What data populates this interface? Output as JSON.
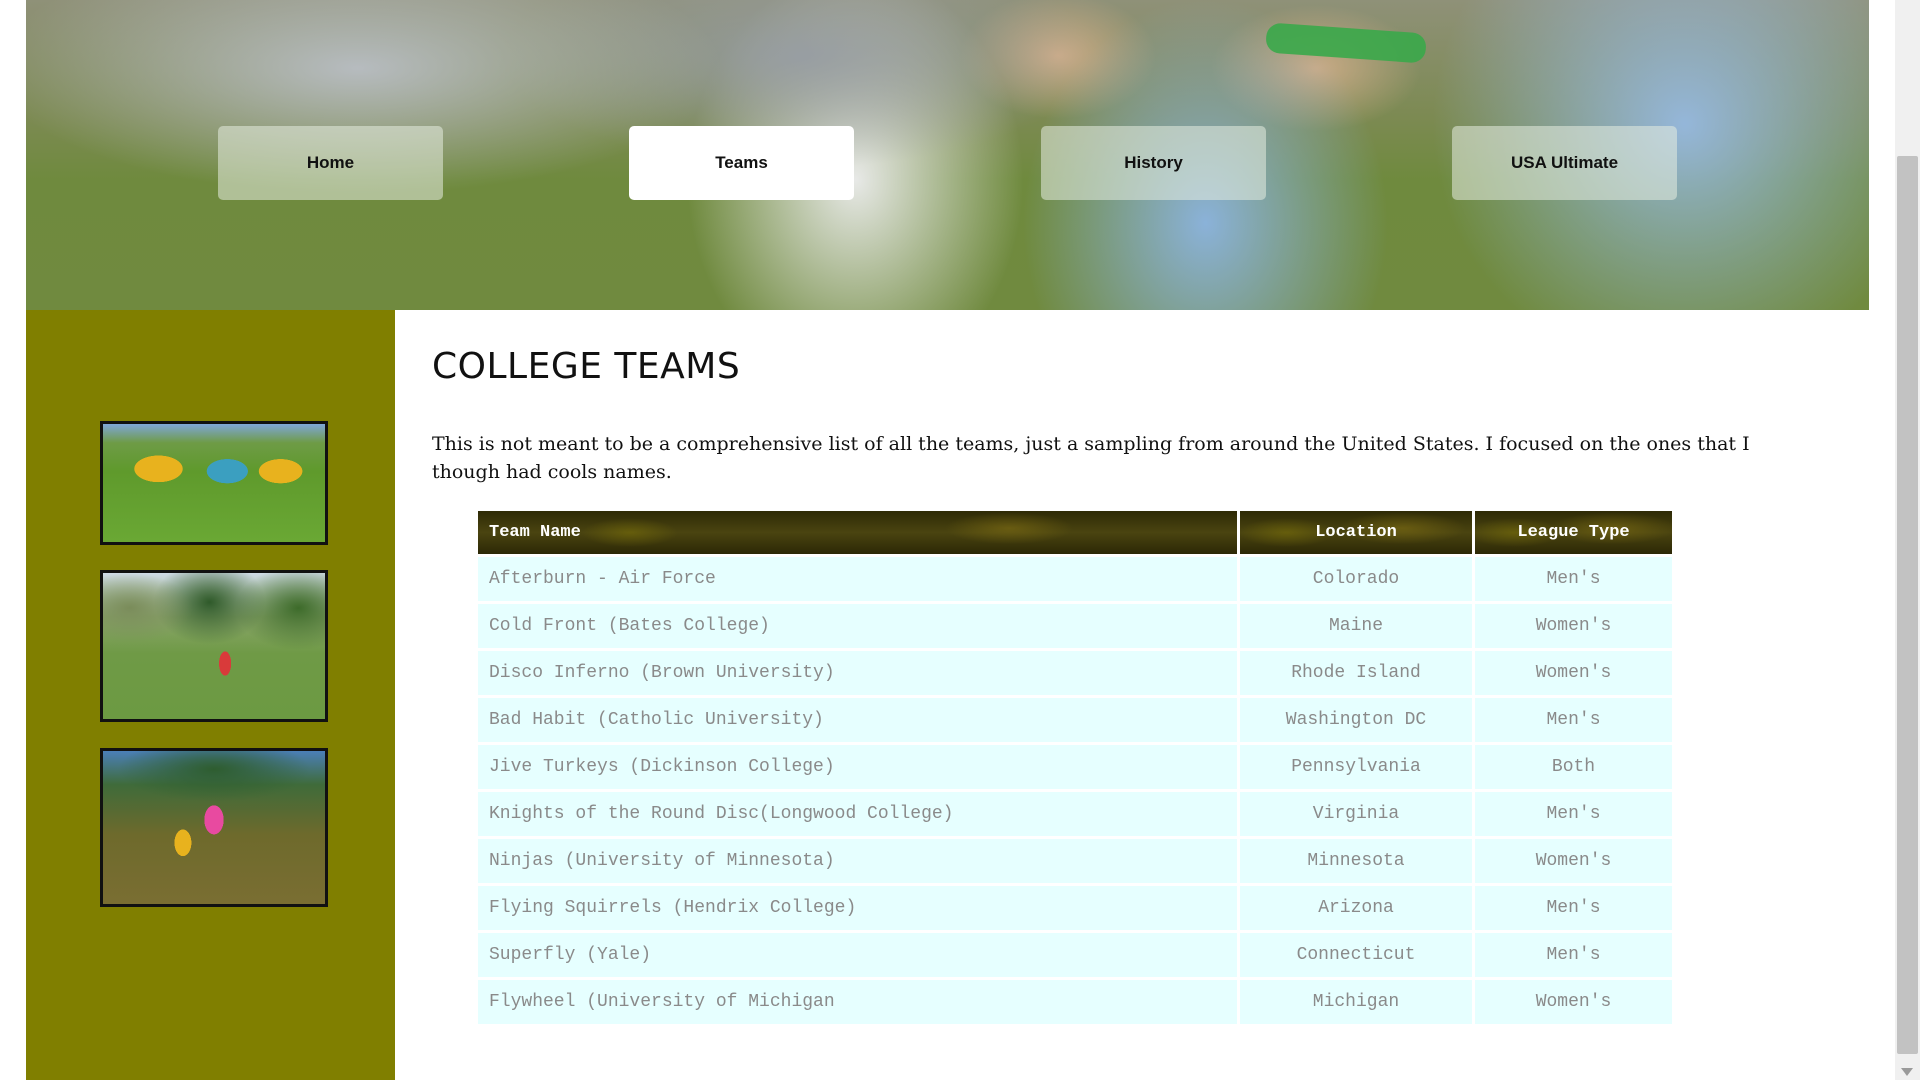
{
  "nav": {
    "items": [
      {
        "label": "Home"
      },
      {
        "label": "Teams"
      },
      {
        "label": "History"
      },
      {
        "label": "USA Ultimate"
      }
    ]
  },
  "main": {
    "title": "COLLEGE TEAMS",
    "intro": "This is not meant to be a comprehensive list of all the teams, just a sampling from around the United States. I focused on the ones that I though had cools names."
  },
  "table": {
    "headers": {
      "name": "Team Name",
      "location": "Location",
      "type": "League Type"
    },
    "rows": [
      {
        "name": "Afterburn - Air Force",
        "location": "Colorado",
        "type": "Men's"
      },
      {
        "name": "Cold Front (Bates College)",
        "location": "Maine",
        "type": "Women's"
      },
      {
        "name": "Disco Inferno (Brown University)",
        "location": "Rhode Island",
        "type": "Women's"
      },
      {
        "name": "Bad Habit (Catholic University)",
        "location": "Washington DC",
        "type": "Men's"
      },
      {
        "name": "Jive Turkeys (Dickinson College)",
        "location": "Pennsylvania",
        "type": "Both"
      },
      {
        "name": "Knights of the Round Disc(Longwood College)",
        "location": "Virginia",
        "type": "Men's"
      },
      {
        "name": "Ninjas (University of Minnesota)",
        "location": "Minnesota",
        "type": "Women's"
      },
      {
        "name": "Flying Squirrels (Hendrix College)",
        "location": "Arizona",
        "type": "Men's"
      },
      {
        "name": "Superfly (Yale)",
        "location": "Connecticut",
        "type": "Men's"
      },
      {
        "name": "Flywheel (University of Michigan",
        "location": "Michigan",
        "type": "Women's"
      }
    ]
  },
  "colors": {
    "sidebar": "#807f00",
    "table_row": "#e6ffff",
    "table_header": "#3a3508"
  }
}
